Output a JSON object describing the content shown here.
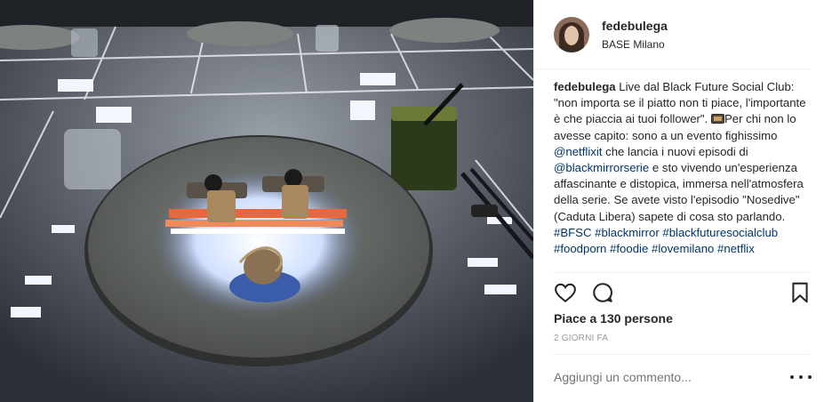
{
  "post": {
    "username": "fedebulega",
    "location": "BASE Milano",
    "caption": {
      "username": "fedebulega",
      "text1": " Live dal Black Future Social Club: \"non importa se il piatto non ti piace, l'importante è che piaccia ai tuoi follower\".",
      "text2": "Per chi non lo avesse capito: sono a un evento fighissimo ",
      "mention_netflix": "@netflixit",
      "text3": " che lancia i nuovi episodi di ",
      "mention_bm": "@blackmirrorserie",
      "text4": " e sto vivendo un'esperienza affascinante e distopica, immersa nell'atmosfera della serie. Se avete visto l'episodio \"Nosedive\" (Caduta Libera) sapete di cosa sto parlando.",
      "hashtags": "#BFSC #blackmirror #blackfuturesocialclub #foodporn #foodie #lovemilano #netflix"
    },
    "likes": "Piace a 130 persone",
    "time": "2 GIORNI FA",
    "comment_placeholder": "Aggiungi un commento...",
    "icons": {
      "like": "heart-icon",
      "comment": "comment-bubble-icon",
      "save": "bookmark-icon",
      "more": "more-options-icon",
      "caption_emoji": "television-icon"
    },
    "colors": {
      "link": "#003569",
      "text": "#262626",
      "muted": "#999999",
      "divider": "#efefef"
    }
  }
}
